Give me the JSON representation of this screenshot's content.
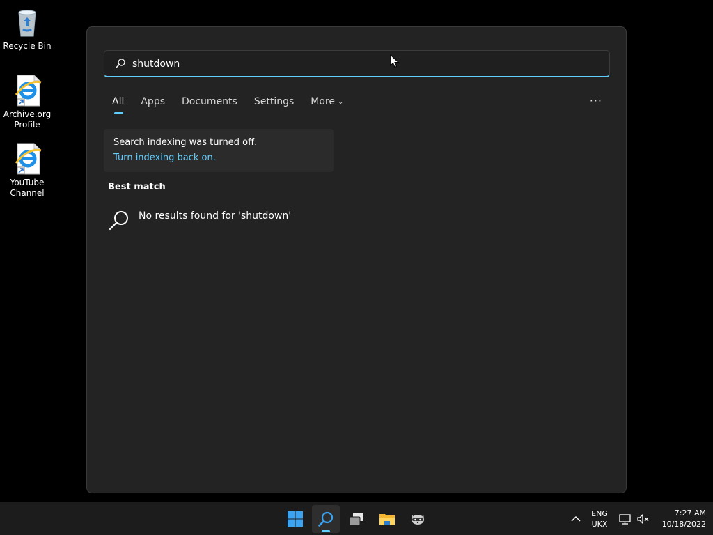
{
  "desktop": {
    "icons": [
      {
        "label": "Recycle Bin",
        "icon": "recycle-bin-icon"
      },
      {
        "label": "Archive.org Profile",
        "icon": "internet-explorer-shortcut-icon"
      },
      {
        "label": "YouTube Channel",
        "icon": "internet-explorer-shortcut-icon"
      }
    ]
  },
  "search": {
    "query": "shutdown",
    "tabs": [
      {
        "label": "All",
        "active": true
      },
      {
        "label": "Apps"
      },
      {
        "label": "Documents"
      },
      {
        "label": "Settings"
      },
      {
        "label": "More"
      }
    ],
    "more_options_icon": "ellipsis-icon",
    "indexing_notice": {
      "message": "Search indexing was turned off.",
      "link": "Turn indexing back on."
    },
    "best_match_heading": "Best match",
    "no_results_text": "No results found for 'shutdown'"
  },
  "taskbar": {
    "apps": [
      {
        "name": "start-button",
        "icon": "windows-logo-icon"
      },
      {
        "name": "search-button",
        "icon": "search-icon",
        "active": true
      },
      {
        "name": "task-view-button",
        "icon": "task-view-icon"
      },
      {
        "name": "file-explorer-button",
        "icon": "folder-icon"
      },
      {
        "name": "app-button",
        "icon": "raccoon-icon"
      }
    ],
    "tray": {
      "language_line1": "ENG",
      "language_line2": "UKX",
      "time": "7:27 AM",
      "date": "10/18/2022"
    }
  },
  "colors": {
    "accent": "#60cdff",
    "panel": "#232323",
    "taskbar": "#1c1c1c"
  }
}
